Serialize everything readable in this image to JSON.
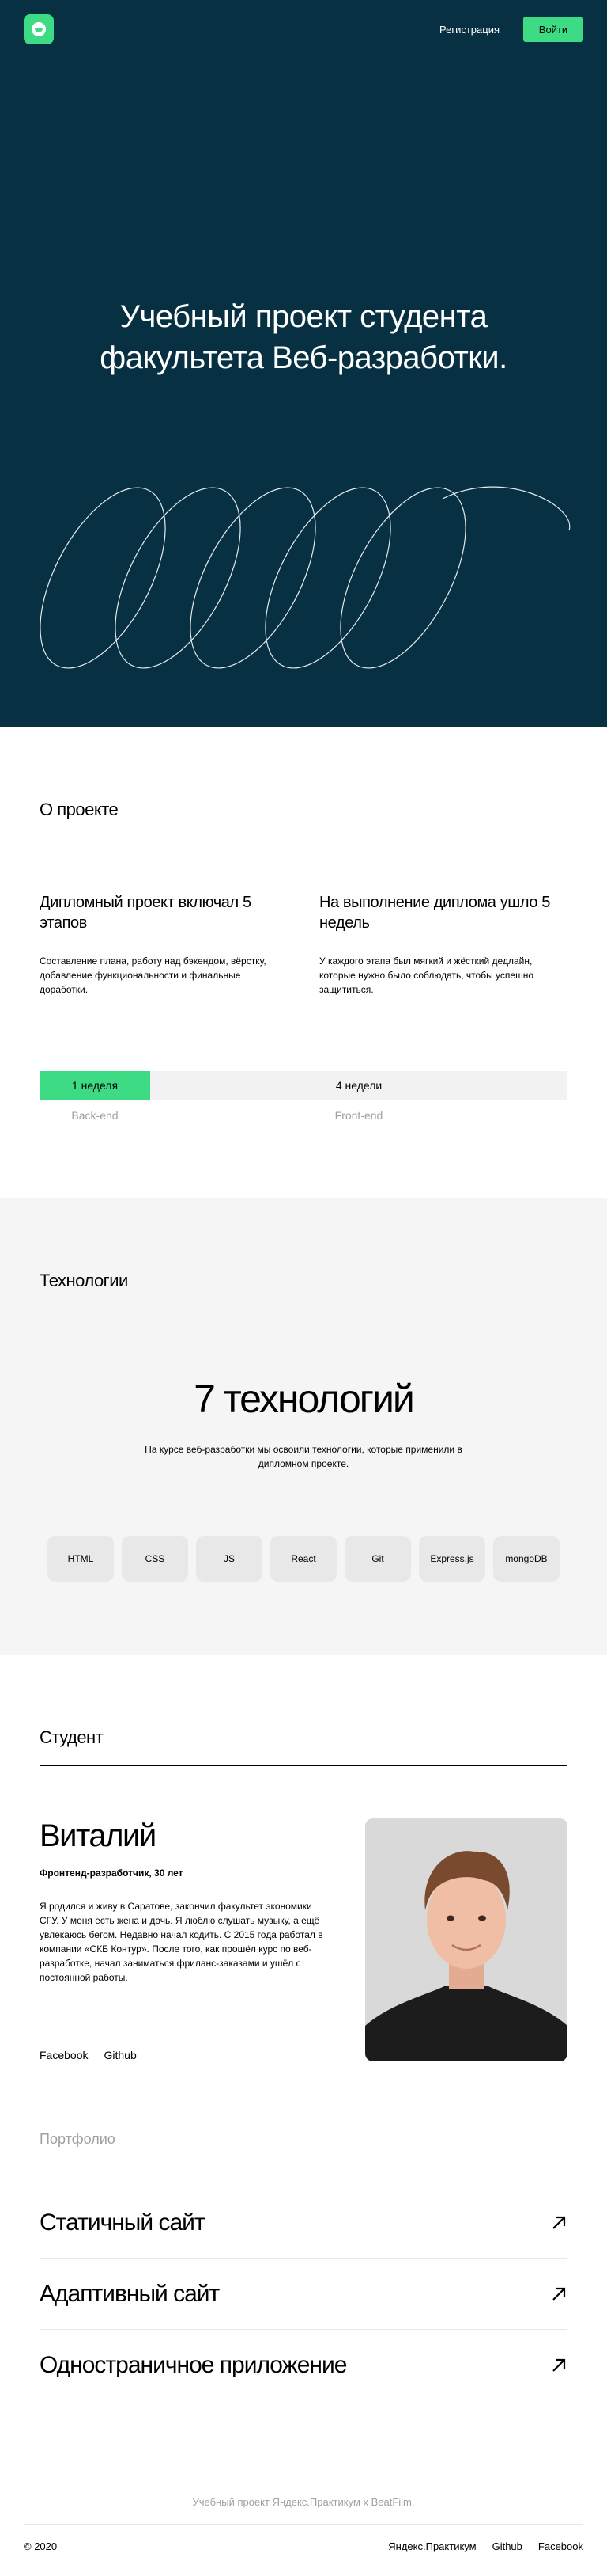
{
  "header": {
    "register_label": "Регистрация",
    "login_label": "Войти"
  },
  "hero": {
    "title": "Учебный проект студента факультета Веб-разработки."
  },
  "about": {
    "title": "О проекте",
    "columns": [
      {
        "heading": "Дипломный проект включал 5 этапов",
        "text": "Составление плана, работу над бэкендом, вёрстку, добавление функциональности и финальные доработки."
      },
      {
        "heading": "На выполнение диплома ушло 5 недель",
        "text": "У каждого этапа был мягкий и жёсткий дедлайн, которые нужно было соблюдать, чтобы успешно защититься."
      }
    ],
    "timeline": {
      "backend_duration": "1 неделя",
      "frontend_duration": "4 недели",
      "backend_label": "Back-end",
      "frontend_label": "Front-end"
    }
  },
  "tech": {
    "title": "Технологии",
    "heading": "7 технологий",
    "text": "На курсе веб-разработки мы освоили технологии, которые применили в дипломном проекте.",
    "items": [
      "HTML",
      "CSS",
      "JS",
      "React",
      "Git",
      "Express.js",
      "mongoDB"
    ]
  },
  "student": {
    "title": "Студент",
    "name": "Виталий",
    "role": "Фронтенд-разработчик, 30 лет",
    "bio": "Я родился и живу в Саратове, закончил факультет экономики СГУ. У меня есть жена и дочь. Я люблю слушать музыку, а ещё увлекаюсь бегом. Недавно начал кодить. С 2015 года работал в компании «СКБ Контур». После того, как прошёл курс по веб-разработке, начал заниматься фриланс-заказами и ушёл с постоянной работы.",
    "links": [
      "Facebook",
      "Github"
    ]
  },
  "portfolio": {
    "title": "Портфолио",
    "items": [
      "Статичный сайт",
      "Адаптивный сайт",
      "Одностраничное приложение"
    ]
  },
  "footer": {
    "note": "Учебный проект Яндекс.Практикум х BeatFilm.",
    "copyright": "© 2020",
    "links": [
      "Яндекс.Практикум",
      "Github",
      "Facebook"
    ]
  },
  "colors": {
    "hero_background": "#073042",
    "accent": "#3ddc84",
    "muted_text": "#a0a0a0",
    "tech_background": "#f5f5f5"
  }
}
